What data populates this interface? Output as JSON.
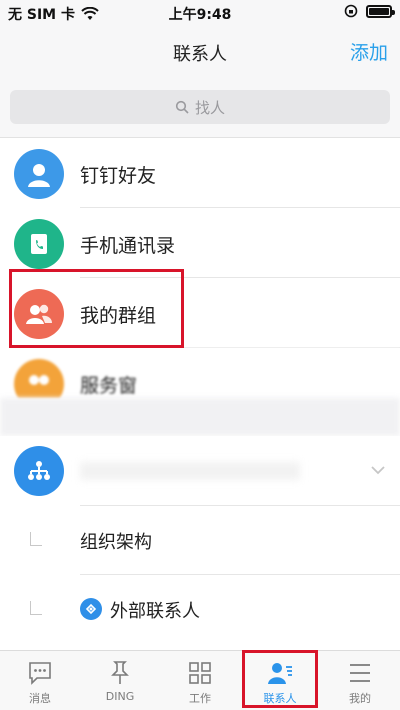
{
  "status_bar": {
    "carrier": "无 SIM 卡",
    "time": "上午9:48"
  },
  "nav": {
    "title": "联系人",
    "action": "添加"
  },
  "search": {
    "placeholder": "找人"
  },
  "list": [
    {
      "label": "钉钉好友",
      "icon": "person-icon",
      "color": "#3d99e8"
    },
    {
      "label": "手机通讯录",
      "icon": "phone-book-icon",
      "color": "#1fb58a"
    },
    {
      "label": "我的群组",
      "icon": "group-icon",
      "color": "#ee6a55"
    },
    {
      "label": "服务窗",
      "icon": "service-icon",
      "color": "#f3a33a"
    }
  ],
  "org": {
    "icon": "org-chart-icon",
    "color": "#2f8fe8",
    "items": [
      {
        "label": "组织架构"
      },
      {
        "label": "外部联系人"
      }
    ]
  },
  "tabs": [
    {
      "label": "消息",
      "icon": "message-icon"
    },
    {
      "label": "DING",
      "icon": "pin-icon"
    },
    {
      "label": "工作",
      "icon": "grid-icon"
    },
    {
      "label": "联系人",
      "icon": "contacts-icon",
      "active": true
    },
    {
      "label": "我的",
      "icon": "menu-icon"
    }
  ],
  "colors": {
    "accent": "#2aa0ea",
    "highlight": "#d8142a"
  }
}
